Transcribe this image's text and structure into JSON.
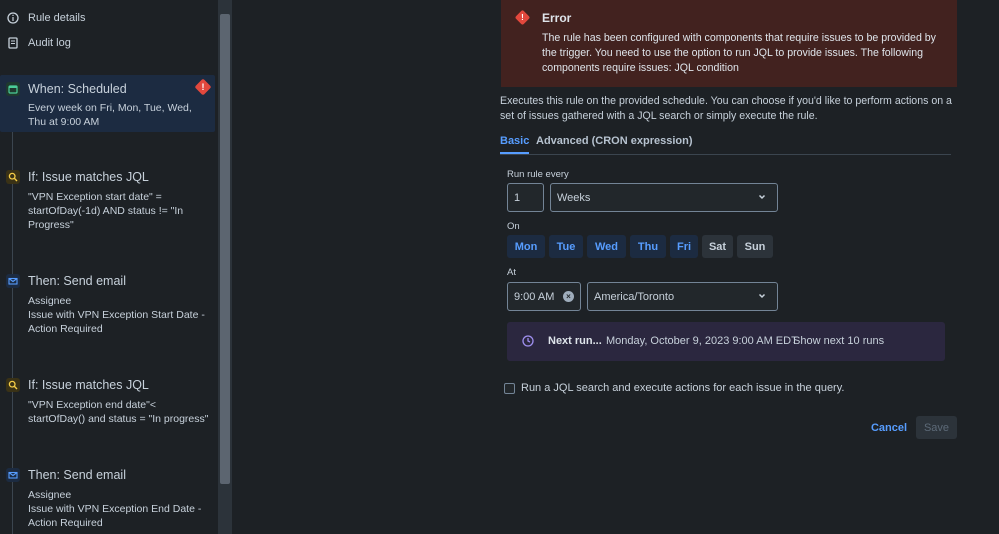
{
  "sidebar": {
    "nav": [
      {
        "label": "Rule details",
        "icon": "info-icon"
      },
      {
        "label": "Audit log",
        "icon": "document-icon"
      }
    ],
    "steps": [
      {
        "title": "When: Scheduled",
        "description": "Every week on Fri, Mon, Tue, Wed, Thu at 9:00 AM",
        "icon": "calendar-icon",
        "color": "#4bce97",
        "selected": true,
        "error": true,
        "error_symbol": "!"
      },
      {
        "title": "If: Issue matches JQL",
        "description": "\"VPN Exception start date\" = startOfDay(-1d) AND status != \"In Progress\"",
        "icon": "search-icon",
        "color": "#f5cd47"
      },
      {
        "title": "Then: Send email",
        "description_lines": [
          "Assignee",
          "Issue with VPN Exception Start Date - Action Required"
        ],
        "icon": "mail-icon",
        "color": "#579dff"
      },
      {
        "title": "If: Issue matches JQL",
        "description": "\"VPN Exception end date\"< startOfDay() and status = \"In progress\"",
        "icon": "search-icon",
        "color": "#f5cd47"
      },
      {
        "title": "Then: Send email",
        "description_lines": [
          "Assignee",
          "Issue with VPN Exception End Date - Action Required"
        ],
        "icon": "mail-icon",
        "color": "#579dff"
      }
    ]
  },
  "error": {
    "title": "Error",
    "symbol": "!",
    "message": "The rule has been configured with components that require issues to be provided by the trigger. You need to use the option to run JQL to provide issues. The following components require issues: JQL condition"
  },
  "intro": "Executes this rule on the provided schedule. You can choose if you'd like to perform actions on a set of issues gathered with a JQL search or simply execute the rule.",
  "tabs": {
    "basic": "Basic",
    "advanced": "Advanced (CRON expression)"
  },
  "form": {
    "run_every_label": "Run rule every",
    "interval_value": "1",
    "interval_unit": "Weeks",
    "on_label": "On",
    "days": [
      {
        "label": "Mon",
        "selected": true
      },
      {
        "label": "Tue",
        "selected": true
      },
      {
        "label": "Wed",
        "selected": true
      },
      {
        "label": "Thu",
        "selected": true
      },
      {
        "label": "Fri",
        "selected": true
      },
      {
        "label": "Sat",
        "selected": false
      },
      {
        "label": "Sun",
        "selected": false
      }
    ],
    "at_label": "At",
    "time_value": "9:00 AM",
    "timezone": "America/Toronto"
  },
  "next_run": {
    "label": "Next run...",
    "date": "Monday, October 9, 2023 9:00 AM EDT",
    "link": "Show next 10 runs"
  },
  "jql_option": "Run a JQL search and execute actions for each issue in the query.",
  "buttons": {
    "cancel": "Cancel",
    "save": "Save"
  },
  "colors": {
    "accent": "#579dff",
    "error": "#e2483d",
    "background": "#1d2125"
  }
}
